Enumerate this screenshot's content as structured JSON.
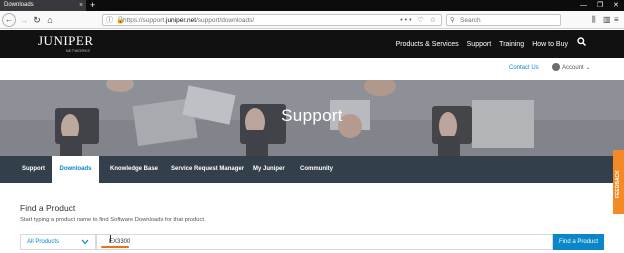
{
  "browser": {
    "tab_title": "Downloads",
    "tab_close": "×",
    "new_tab": "+",
    "window_controls": [
      "—",
      "❐",
      "✕"
    ],
    "url_prefix": "https://support.",
    "url_domain": "juniper.net",
    "url_path": "/support/downloads/",
    "url_actions": "••• ♡ ☆",
    "search_placeholder": "Search"
  },
  "site": {
    "logo": "JUNIPER",
    "logo_sub": "NETWORKS",
    "nav": [
      "Products & Services",
      "Support",
      "Training",
      "How to Buy"
    ],
    "contact_us": "Contact Us",
    "account": "Account"
  },
  "hero": {
    "title": "Support"
  },
  "subnav": [
    "Support",
    "Downloads",
    "Knowledge Base",
    "Service Request Manager",
    "My Juniper",
    "Community"
  ],
  "feedback": "FEEDBACK",
  "find": {
    "title": "Find a Product",
    "description": "Start typing a product name to find Software Downloads for that product.",
    "select_value": "All Products",
    "input_value": "EX3300",
    "button": "Find a Product"
  },
  "colors": {
    "accent": "#0b87c9",
    "header_bg": "#111111",
    "subnav_bg": "#343f4c",
    "feedback": "#f38a25"
  }
}
